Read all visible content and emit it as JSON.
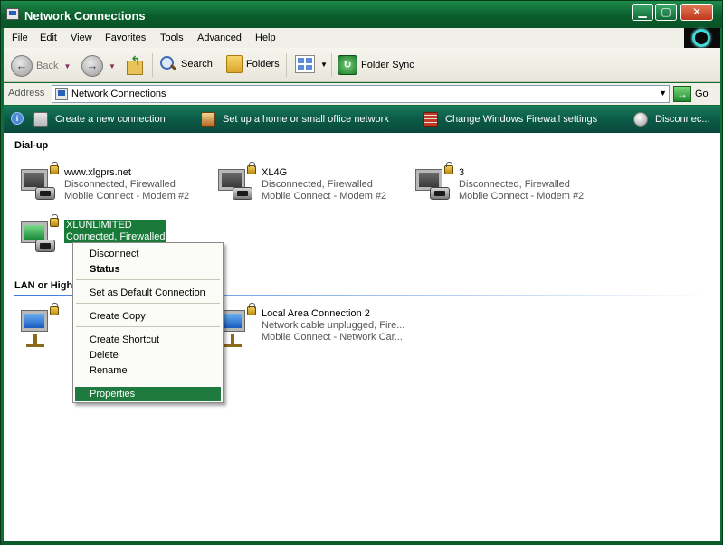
{
  "window": {
    "title": "Network Connections",
    "minimize": "▁",
    "maximize": "▢",
    "close": "✕"
  },
  "menu": [
    "File",
    "Edit",
    "View",
    "Favorites",
    "Tools",
    "Advanced",
    "Help"
  ],
  "toolbar": {
    "back": "Back",
    "search": "Search",
    "folders": "Folders",
    "folder_sync": "Folder Sync"
  },
  "address": {
    "label": "Address",
    "value": "Network Connections",
    "go": "Go"
  },
  "tasks": {
    "create": "Create a new connection",
    "home_network": "Set up a home or small office network",
    "firewall": "Change Windows Firewall settings",
    "disconnect": "Disconnec..."
  },
  "groups": {
    "dialup": "Dial-up",
    "lan": "LAN or High"
  },
  "connections": {
    "dialup": [
      {
        "name": "www.xlgprs.net",
        "status": "Disconnected, Firewalled",
        "device": "Mobile Connect - Modem #2"
      },
      {
        "name": "XL4G",
        "status": "Disconnected, Firewalled",
        "device": "Mobile Connect - Modem #2"
      },
      {
        "name": "3",
        "status": "Disconnected, Firewalled",
        "device": "Mobile Connect - Modem #2"
      },
      {
        "name": "XLUNLIMITED",
        "status": "Connected, Firewalled"
      }
    ],
    "lan": [
      {
        "name": "Local Area Connection 2",
        "status": "Network cable unplugged, Fire...",
        "device": "Mobile Connect - Network Car..."
      }
    ]
  },
  "context_menu": {
    "disconnect": "Disconnect",
    "status": "Status",
    "set_default": "Set as Default Connection",
    "create_copy": "Create Copy",
    "create_shortcut": "Create Shortcut",
    "delete": "Delete",
    "rename": "Rename",
    "properties": "Properties"
  },
  "colors": {
    "titlebar": "#0b5e2c",
    "taskbar": "#0b5a48",
    "highlight": "#1e7a3e",
    "group_line": "#3a7ad8"
  }
}
